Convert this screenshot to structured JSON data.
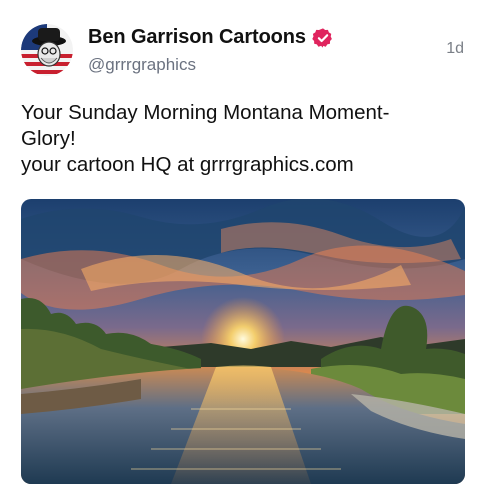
{
  "post": {
    "author_name": "Ben Garrison Cartoons",
    "handle": "@grrrgraphics",
    "timestamp": "1d",
    "text_lines": [
      "Your Sunday Morning Montana Moment-",
      "Glory!",
      "your cartoon HQ at grrrgraphics.com"
    ]
  },
  "icons": {
    "avatar": "avatar-icon",
    "verified": "verified-badge-icon"
  },
  "colors": {
    "verified": "#e0245e",
    "handle": "#6b7280",
    "timestamp": "#7a7f87"
  }
}
